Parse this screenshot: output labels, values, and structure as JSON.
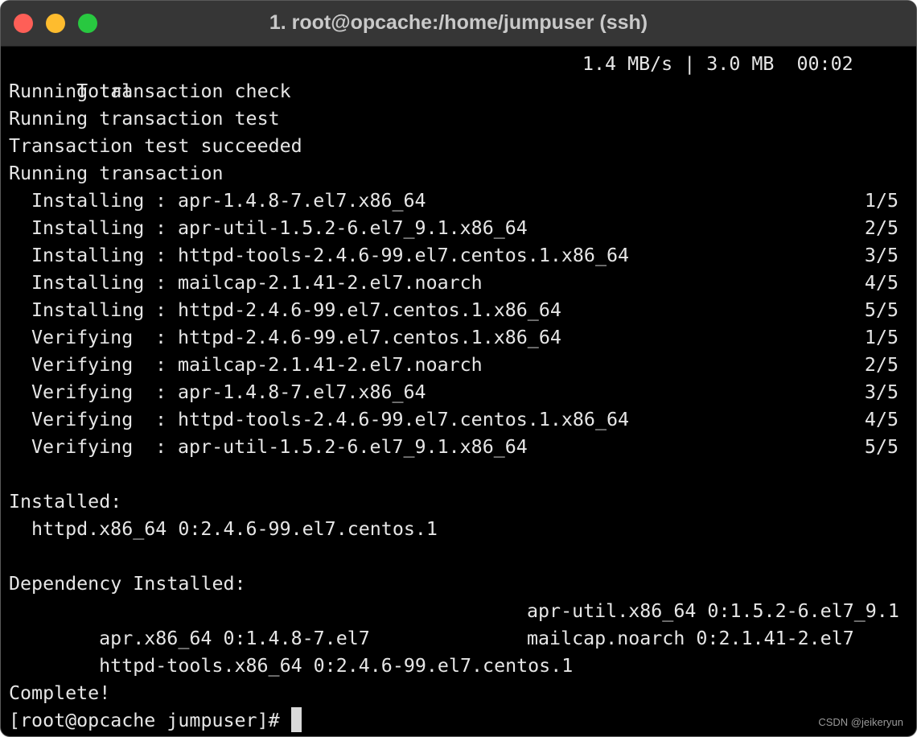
{
  "window": {
    "title": "1. root@opcache:/home/jumpuser (ssh)",
    "colors": {
      "close": "#fe5f57",
      "minimize": "#febc2e",
      "zoom": "#28c840",
      "background": "#000000",
      "text": "#e6e6e6"
    }
  },
  "terminal": {
    "total_label": "Total",
    "total_stats": "1.4 MB/s | 3.0 MB  00:02",
    "status_lines": [
      "Running transaction check",
      "Running transaction test",
      "Transaction test succeeded",
      "Running transaction"
    ],
    "transactions": [
      {
        "action": "Installing",
        "package": "apr-1.4.8-7.el7.x86_64",
        "progress": "1/5"
      },
      {
        "action": "Installing",
        "package": "apr-util-1.5.2-6.el7_9.1.x86_64",
        "progress": "2/5"
      },
      {
        "action": "Installing",
        "package": "httpd-tools-2.4.6-99.el7.centos.1.x86_64",
        "progress": "3/5"
      },
      {
        "action": "Installing",
        "package": "mailcap-2.1.41-2.el7.noarch",
        "progress": "4/5"
      },
      {
        "action": "Installing",
        "package": "httpd-2.4.6-99.el7.centos.1.x86_64",
        "progress": "5/5"
      },
      {
        "action": "Verifying",
        "package": "httpd-2.4.6-99.el7.centos.1.x86_64",
        "progress": "1/5"
      },
      {
        "action": "Verifying",
        "package": "mailcap-2.1.41-2.el7.noarch",
        "progress": "2/5"
      },
      {
        "action": "Verifying",
        "package": "apr-1.4.8-7.el7.x86_64",
        "progress": "3/5"
      },
      {
        "action": "Verifying",
        "package": "httpd-tools-2.4.6-99.el7.centos.1.x86_64",
        "progress": "4/5"
      },
      {
        "action": "Verifying",
        "package": "apr-util-1.5.2-6.el7_9.1.x86_64",
        "progress": "5/5"
      }
    ],
    "separator": ":",
    "installed_header": "Installed:",
    "installed_package": "httpd.x86_64 0:2.4.6-99.el7.centos.1",
    "dependency_header": "Dependency Installed:",
    "dependencies": [
      [
        "apr.x86_64 0:1.4.8-7.el7",
        "apr-util.x86_64 0:1.5.2-6.el7_9.1"
      ],
      [
        "httpd-tools.x86_64 0:2.4.6-99.el7.centos.1",
        "mailcap.noarch 0:2.1.41-2.el7"
      ]
    ],
    "complete": "Complete!",
    "prompt": "[root@opcache jumpuser]# "
  },
  "watermark": "CSDN @jeikeryun"
}
